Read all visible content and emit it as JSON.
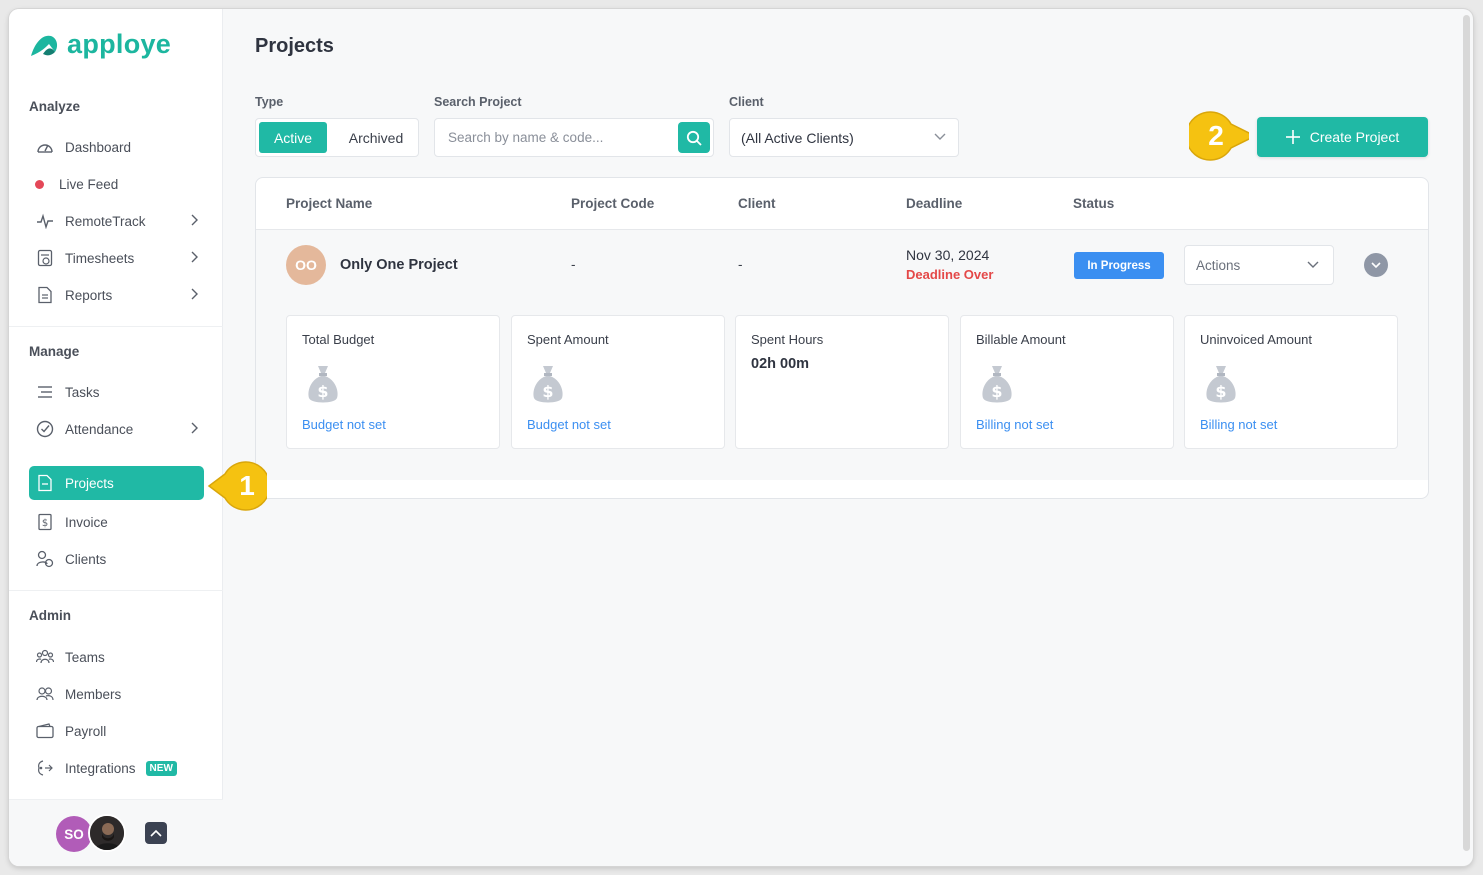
{
  "app": {
    "logo_text": "apploye"
  },
  "sidebar": {
    "sections": [
      {
        "title": "Analyze"
      },
      {
        "title": "Manage"
      },
      {
        "title": "Admin"
      }
    ],
    "items": [
      {
        "label": "Dashboard"
      },
      {
        "label": "Live Feed"
      },
      {
        "label": "RemoteTrack"
      },
      {
        "label": "Timesheets"
      },
      {
        "label": "Reports"
      },
      {
        "label": "Tasks"
      },
      {
        "label": "Attendance"
      },
      {
        "label": "Projects"
      },
      {
        "label": "Invoice"
      },
      {
        "label": "Clients"
      },
      {
        "label": "Teams"
      },
      {
        "label": "Members"
      },
      {
        "label": "Payroll"
      },
      {
        "label": "Integrations",
        "badge": "NEW"
      }
    ],
    "user": {
      "initials": "SO"
    }
  },
  "page": {
    "title": "Projects"
  },
  "filters": {
    "type_label": "Type",
    "type_active": "Active",
    "type_archived": "Archived",
    "search_label": "Search Project",
    "search_placeholder": "Search by name & code...",
    "search_value": "",
    "client_label": "Client",
    "client_value": "(All Active Clients)"
  },
  "create_button": {
    "label": "Create Project"
  },
  "table": {
    "columns": [
      "Project Name",
      "Project Code",
      "Client",
      "Deadline",
      "Status"
    ],
    "rows": [
      {
        "initials": "OO",
        "name": "Only One Project",
        "code": "-",
        "client": "-",
        "deadline": "Nov 30, 2024",
        "deadline_note": "Deadline Over",
        "status": "In Progress",
        "actions_label": "Actions",
        "stats": [
          {
            "title": "Total Budget",
            "link": "Budget not set"
          },
          {
            "title": "Spent Amount",
            "link": "Budget not set"
          },
          {
            "title": "Spent Hours",
            "value": "02h 00m"
          },
          {
            "title": "Billable Amount",
            "link": "Billing not set"
          },
          {
            "title": "Uninvoiced Amount",
            "link": "Billing not set"
          }
        ]
      }
    ]
  },
  "callouts": [
    {
      "number": "1"
    },
    {
      "number": "2"
    }
  ],
  "colors": {
    "accent": "#20b9a5",
    "status_blue": "#3b8ff1",
    "danger": "#e44848",
    "callout": "#f5c211"
  }
}
